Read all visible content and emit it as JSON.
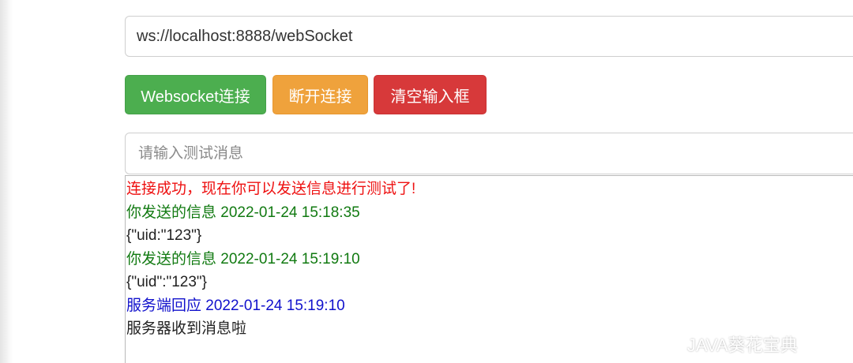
{
  "connection": {
    "url_value": "ws://localhost:8888/webSocket"
  },
  "buttons": {
    "connect": "Websocket连接",
    "disconnect": "断开连接",
    "clear": "清空输入框"
  },
  "message_input": {
    "placeholder": "请输入测试消息",
    "value": ""
  },
  "log": {
    "lines": [
      {
        "text": "连接成功，现在你可以发送信息进行测试了!",
        "color": "#ee1111"
      },
      {
        "text": "你发送的信息 2022-01-24 15:18:35",
        "color": "#117a11"
      },
      {
        "text": "{\"uid:\"123\"}",
        "color": "#222222"
      },
      {
        "text": "你发送的信息 2022-01-24 15:19:10",
        "color": "#117a11"
      },
      {
        "text": "{\"uid\":\"123\"}",
        "color": "#222222"
      },
      {
        "text": "服务端回应 2022-01-24 15:19:10",
        "color": "#1111cc"
      },
      {
        "text": "服务器收到消息啦",
        "color": "#222222"
      }
    ]
  },
  "watermark": {
    "text": "JAVA葵花宝典",
    "icon": "wechat-icon"
  },
  "colors": {
    "connect_button": "#4cae4f",
    "disconnect_button": "#efa23c",
    "clear_button": "#d7393a"
  }
}
